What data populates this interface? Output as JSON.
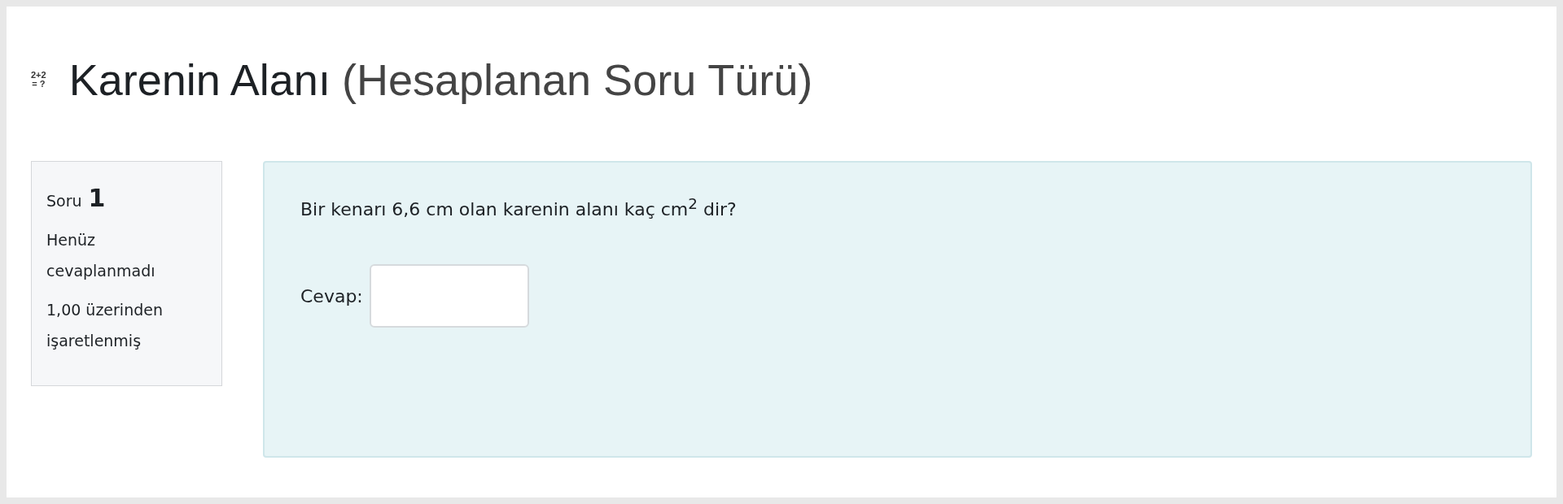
{
  "header": {
    "icon_lines": [
      "2+2",
      "= ?"
    ],
    "title": "Karenin Alanı",
    "subtitle": "(Hesaplanan Soru Türü)"
  },
  "info": {
    "label": "Soru",
    "number": "1",
    "state": "Henüz cevaplanmadı",
    "grade": "1,00 üzerinden işaretlenmiş"
  },
  "question": {
    "text": "Bir kenarı 6,6 cm olan karenin alanı kaç cm$^{2}$ dir?",
    "answer_label": "Cevap:"
  }
}
